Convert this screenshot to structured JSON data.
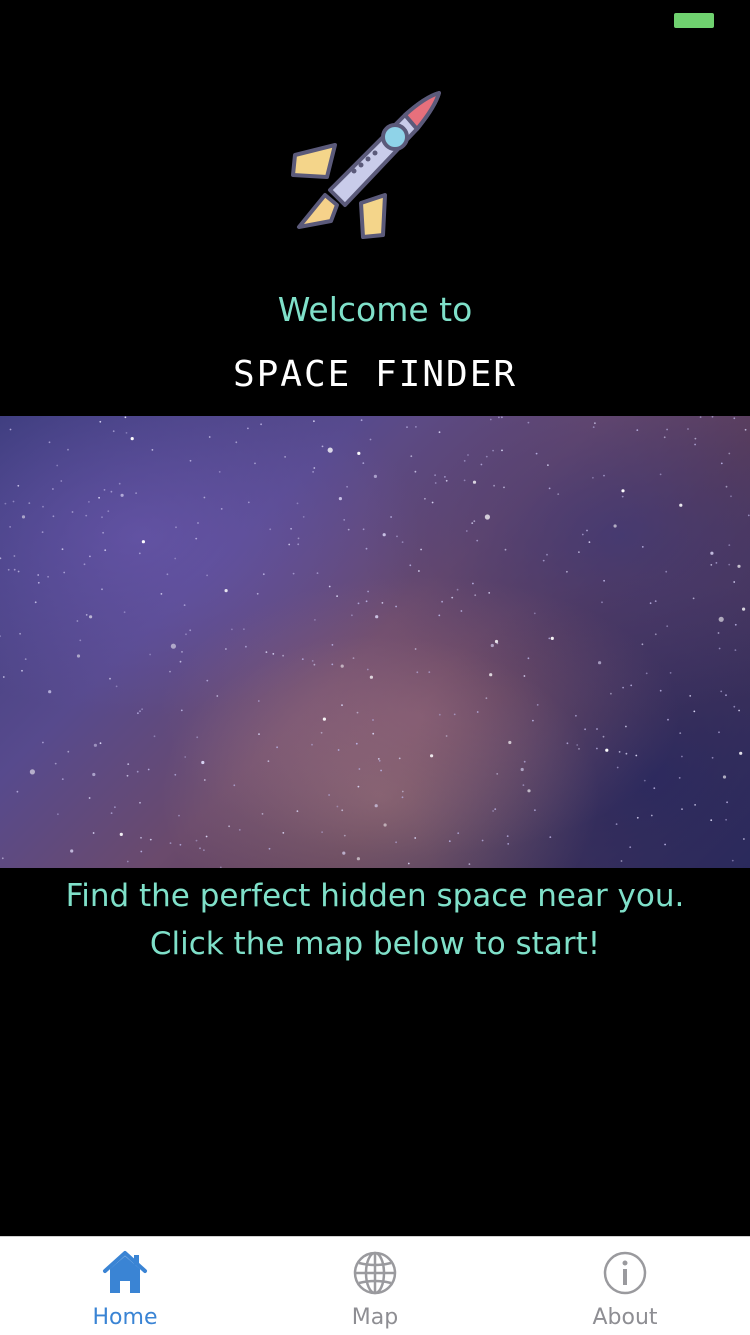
{
  "status_bar": {
    "battery_color": "#6fd16f"
  },
  "header": {
    "icon": "rocket-icon",
    "welcome": "Welcome to",
    "title": "SPACE FINDER"
  },
  "hero_image": {
    "subject": "galaxy-starfield"
  },
  "tagline": {
    "line1": "Find the perfect hidden space near you.",
    "line2": "Click the map below to start!"
  },
  "tab_bar": {
    "active_color": "#3a84d4",
    "inactive_color": "#8e8e93",
    "tabs": [
      {
        "label": "Home",
        "icon": "home-icon",
        "active": true
      },
      {
        "label": "Map",
        "icon": "globe-icon",
        "active": false
      },
      {
        "label": "About",
        "icon": "info-icon",
        "active": false
      }
    ]
  }
}
